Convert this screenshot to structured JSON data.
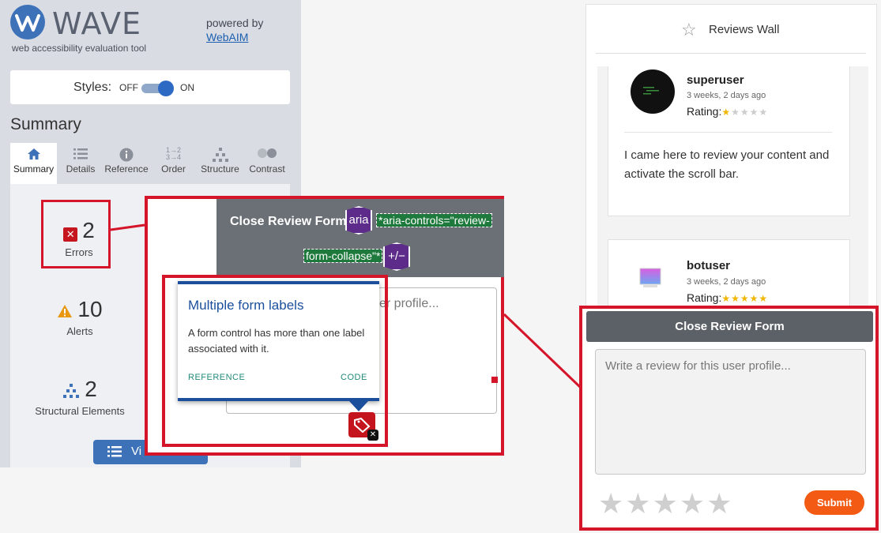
{
  "wave": {
    "logo_letter": "W",
    "title": "WAVE",
    "subtitle": "web accessibility evaluation tool",
    "powered_by": "powered by",
    "webaim_link": "WebAIM",
    "styles_label": "Styles:",
    "styles_off": "OFF",
    "styles_on": "ON",
    "styles_enabled": true,
    "summary_heading": "Summary",
    "tabs": [
      {
        "label": "Summary",
        "icon": "home-icon",
        "active": true
      },
      {
        "label": "Details",
        "icon": "list-icon"
      },
      {
        "label": "Reference",
        "icon": "info-icon"
      },
      {
        "label": "Order",
        "icon": "order-icon"
      },
      {
        "label": "Structure",
        "icon": "structure-icon"
      },
      {
        "label": "Contrast",
        "icon": "contrast-icon"
      }
    ],
    "stats": {
      "errors": {
        "count": "2",
        "label": "Errors"
      },
      "alerts": {
        "count": "10",
        "label": "Alerts"
      },
      "structural": {
        "count": "2",
        "label": "Structural Elements"
      }
    },
    "view_button": "Vi"
  },
  "zoom": {
    "form_title": "Close Review Form",
    "aria_badge": "aria",
    "aria_code_1": "*aria-controls=\"review-",
    "aria_code_2": "form-collapse\"*",
    "toggle_badge": "+/−",
    "textarea_partial": "er profile...",
    "tooltip": {
      "title": "Multiple form labels",
      "body": "A form control has more than one label associated with it.",
      "reference": "REFERENCE",
      "code": "CODE"
    }
  },
  "reviews_wall": {
    "title": "Reviews Wall",
    "reviews": [
      {
        "user": "superuser",
        "time": "3 weeks, 2 days ago",
        "rating_label": "Rating:",
        "rating": 1,
        "text": "I came here to review your content and activate the scroll bar."
      },
      {
        "user": "botuser",
        "time": "3 weeks, 2 days ago",
        "rating_label": "Rating:",
        "rating": 5,
        "text": ""
      }
    ]
  },
  "form": {
    "close_button": "Close Review Form",
    "placeholder": "Write a review for this user profile...",
    "star_count": 5,
    "submit": "Submit"
  },
  "colors": {
    "wave_blue": "#3d72b8",
    "error_red": "#d5152a",
    "aria_purple": "#5d2b8a",
    "code_green": "#1e7a3c",
    "submit_orange": "#f35b14",
    "star_gold": "#f1b600"
  }
}
